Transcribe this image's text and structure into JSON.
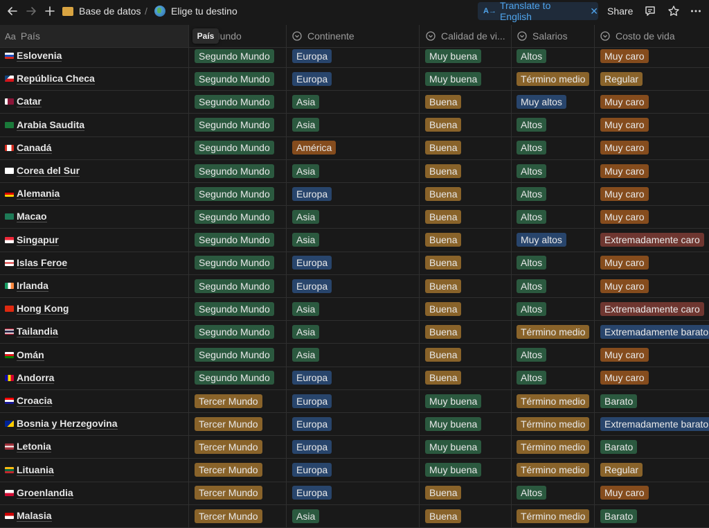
{
  "topbar": {
    "breadcrumb_1": "Base de datos",
    "breadcrumb_sep": "/",
    "breadcrumb_2": "Elige tu destino",
    "translate_label": "Translate to English",
    "share_label": "Share"
  },
  "tooltip": "País",
  "columns": {
    "pais": "País",
    "mundo": "Mundo",
    "continente": "Continente",
    "calidad": "Calidad de vi...",
    "salarios": "Salarios",
    "costo": "Costo de vida"
  },
  "colors": {
    "green": "#2b593f",
    "blue": "#28456c",
    "orange": "#854c1d",
    "yellow": "#89632a",
    "red": "#6e3630",
    "brown": "#603b2c",
    "accent": "#4fa3ea"
  },
  "rows": [
    {
      "pais": "Eslovenia",
      "mundo": "Segundo Mundo",
      "continente": "Europa",
      "calidad": "Muy buena",
      "salarios": "Altos",
      "costo": "Muy caro"
    },
    {
      "pais": "República Checa",
      "mundo": "Segundo Mundo",
      "continente": "Europa",
      "calidad": "Muy buena",
      "salarios": "Término medio",
      "costo": "Regular"
    },
    {
      "pais": "Catar",
      "mundo": "Segundo Mundo",
      "continente": "Asia",
      "calidad": "Buena",
      "salarios": "Muy altos",
      "costo": "Muy caro"
    },
    {
      "pais": "Arabia Saudita",
      "mundo": "Segundo Mundo",
      "continente": "Asia",
      "calidad": "Buena",
      "salarios": "Altos",
      "costo": "Muy caro"
    },
    {
      "pais": "Canadá",
      "mundo": "Segundo Mundo",
      "continente": "América",
      "calidad": "Buena",
      "salarios": "Altos",
      "costo": "Muy caro"
    },
    {
      "pais": "Corea del Sur",
      "mundo": "Segundo Mundo",
      "continente": "Asia",
      "calidad": "Buena",
      "salarios": "Altos",
      "costo": "Muy caro"
    },
    {
      "pais": "Alemania",
      "mundo": "Segundo Mundo",
      "continente": "Europa",
      "calidad": "Buena",
      "salarios": "Altos",
      "costo": "Muy caro"
    },
    {
      "pais": "Macao",
      "mundo": "Segundo Mundo",
      "continente": "Asia",
      "calidad": "Buena",
      "salarios": "Altos",
      "costo": "Muy caro"
    },
    {
      "pais": "Singapur",
      "mundo": "Segundo Mundo",
      "continente": "Asia",
      "calidad": "Buena",
      "salarios": "Muy altos",
      "costo": "Extremadamente caro"
    },
    {
      "pais": "Islas Feroe",
      "mundo": "Segundo Mundo",
      "continente": "Europa",
      "calidad": "Buena",
      "salarios": "Altos",
      "costo": "Muy caro"
    },
    {
      "pais": "Irlanda",
      "mundo": "Segundo Mundo",
      "continente": "Europa",
      "calidad": "Buena",
      "salarios": "Altos",
      "costo": "Muy caro"
    },
    {
      "pais": "Hong Kong",
      "mundo": "Segundo Mundo",
      "continente": "Asia",
      "calidad": "Buena",
      "salarios": "Altos",
      "costo": "Extremadamente caro"
    },
    {
      "pais": "Tailandia",
      "mundo": "Segundo Mundo",
      "continente": "Asia",
      "calidad": "Buena",
      "salarios": "Término medio",
      "costo": "Extremadamente barato"
    },
    {
      "pais": "Omán",
      "mundo": "Segundo Mundo",
      "continente": "Asia",
      "calidad": "Buena",
      "salarios": "Altos",
      "costo": "Muy caro"
    },
    {
      "pais": "Andorra",
      "mundo": "Segundo Mundo",
      "continente": "Europa",
      "calidad": "Buena",
      "salarios": "Altos",
      "costo": "Muy caro"
    },
    {
      "pais": "Croacia",
      "mundo": "Tercer Mundo",
      "continente": "Europa",
      "calidad": "Muy buena",
      "salarios": "Término medio",
      "costo": "Barato"
    },
    {
      "pais": "Bosnia y Herzegovina",
      "mundo": "Tercer Mundo",
      "continente": "Europa",
      "calidad": "Muy buena",
      "salarios": "Término medio",
      "costo": "Extremadamente barato"
    },
    {
      "pais": "Letonia",
      "mundo": "Tercer Mundo",
      "continente": "Europa",
      "calidad": "Muy buena",
      "salarios": "Término medio",
      "costo": "Barato"
    },
    {
      "pais": "Lituania",
      "mundo": "Tercer Mundo",
      "continente": "Europa",
      "calidad": "Muy buena",
      "salarios": "Término medio",
      "costo": "Regular"
    },
    {
      "pais": "Groenlandia",
      "mundo": "Tercer Mundo",
      "continente": "Europa",
      "calidad": "Buena",
      "salarios": "Altos",
      "costo": "Muy caro"
    },
    {
      "pais": "Malasia",
      "mundo": "Tercer Mundo",
      "continente": "Asia",
      "calidad": "Buena",
      "salarios": "Término medio",
      "costo": "Barato"
    }
  ]
}
